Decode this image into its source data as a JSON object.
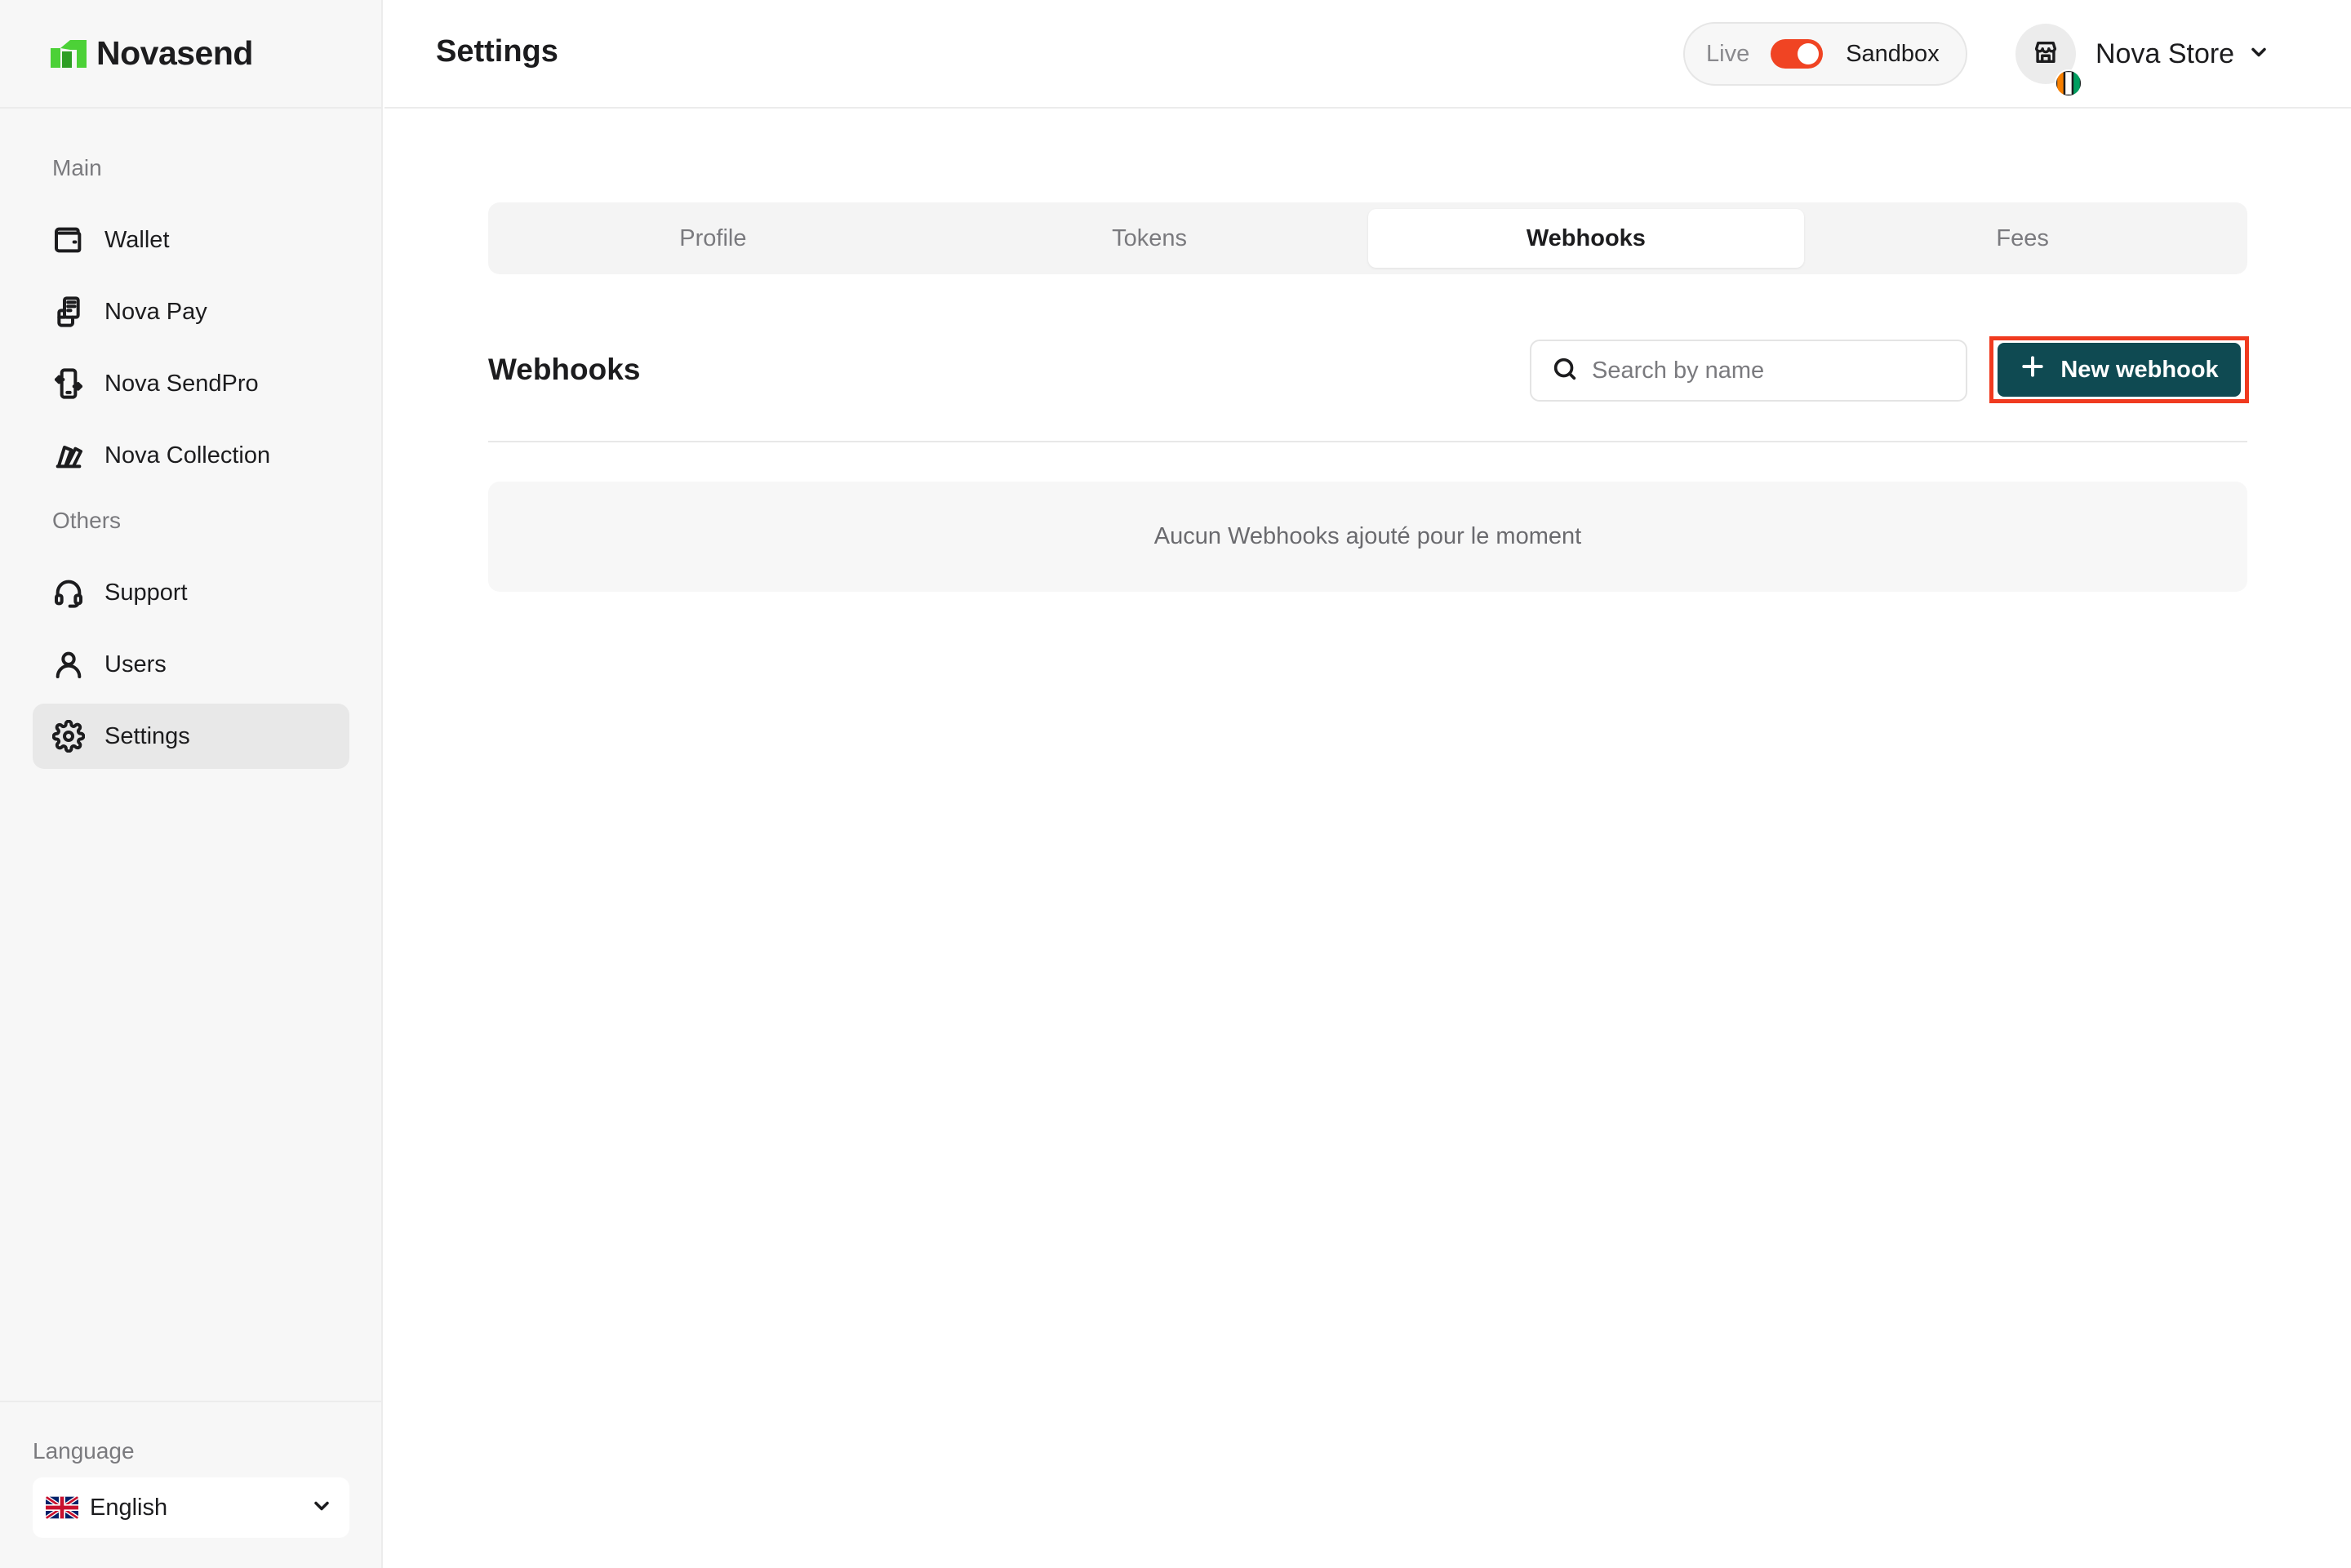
{
  "brand": {
    "name": "Novasend",
    "accent": "#4cd137"
  },
  "sidebar": {
    "sections": {
      "main": "Main",
      "others": "Others"
    },
    "items": [
      {
        "label": "Wallet",
        "icon": "wallet-icon"
      },
      {
        "label": "Nova Pay",
        "icon": "pos-terminal-icon"
      },
      {
        "label": "Nova SendPro",
        "icon": "phone-transfer-icon"
      },
      {
        "label": "Nova Collection",
        "icon": "cards-icon"
      },
      {
        "label": "Support",
        "icon": "headset-icon"
      },
      {
        "label": "Users",
        "icon": "user-icon"
      },
      {
        "label": "Settings",
        "icon": "gear-icon",
        "active": true
      }
    ],
    "language": {
      "label": "Language",
      "value": "English",
      "flag": "uk-flag-icon"
    }
  },
  "header": {
    "title": "Settings",
    "env": {
      "live": "Live",
      "sandbox": "Sandbox",
      "toggle_color": "#f04423"
    },
    "account": {
      "name": "Nova Store",
      "flag": "ivory-coast-flag-icon"
    }
  },
  "tabs": [
    {
      "label": "Profile"
    },
    {
      "label": "Tokens"
    },
    {
      "label": "Webhooks",
      "active": true
    },
    {
      "label": "Fees"
    }
  ],
  "webhooks": {
    "title": "Webhooks",
    "search_placeholder": "Search by name",
    "new_button": "New webhook",
    "button_color": "#0f4a52",
    "empty_message": "Aucun Webhooks ajouté pour le moment"
  }
}
